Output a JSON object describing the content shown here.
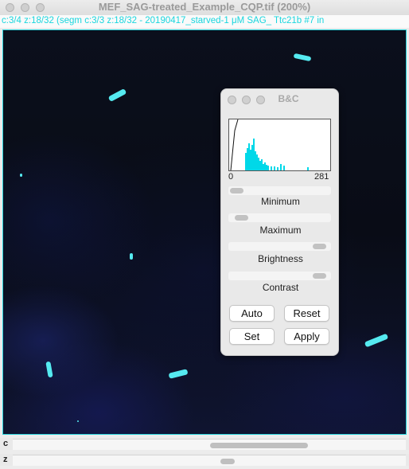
{
  "window": {
    "title": "MEF_SAG-treated_Example_CQP.tif (200%)",
    "info": "c:3/4 z:18/32 (segm c:3/3 z:18/32 - 20190417_starved-1 μM SAG_ Ttc21b #7 in"
  },
  "colors": {
    "accent": "#29d3db",
    "blob": "#55eaf0",
    "histogram": "#00d8e8"
  },
  "scrollbars": {
    "c_label": "c",
    "z_label": "z"
  },
  "bc_panel": {
    "title": "B&C",
    "hist_min": "0",
    "hist_max": "281",
    "minimum_label": "Minimum",
    "maximum_label": "Maximum",
    "brightness_label": "Brightness",
    "contrast_label": "Contrast",
    "buttons": {
      "auto": "Auto",
      "reset": "Reset",
      "set": "Set",
      "apply": "Apply"
    }
  }
}
